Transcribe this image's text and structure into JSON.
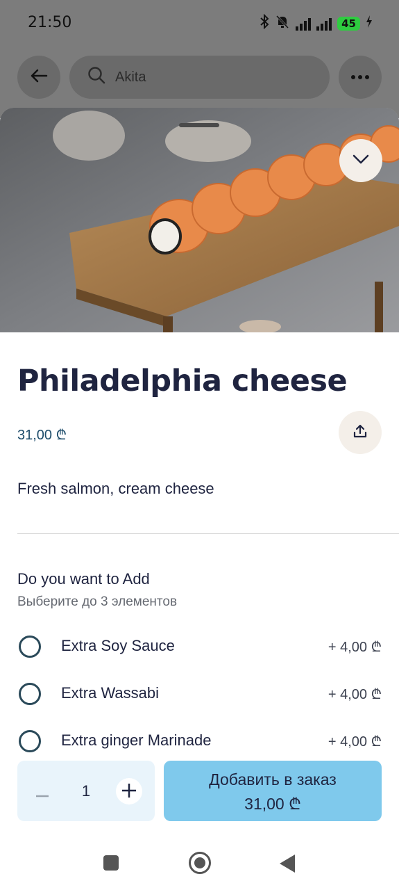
{
  "status_bar": {
    "time": "21:50",
    "icons": [
      "bluetooth-icon",
      "mute-icon",
      "signal-icon",
      "signal-icon"
    ],
    "battery": "45"
  },
  "search": {
    "value": "Akita"
  },
  "product": {
    "title": "Philadelphia cheese",
    "price": "31,00 ₾",
    "description": "Fresh salmon, cream cheese"
  },
  "addons": {
    "title": "Do you want to Add",
    "subtitle": "Выберите до 3 элементов",
    "options": [
      {
        "label": "Extra Soy Sauce",
        "price": "+ 4,00 ₾"
      },
      {
        "label": "Extra Wassabi",
        "price": "+ 4,00 ₾"
      },
      {
        "label": "Extra ginger Marinade",
        "price": "+ 4,00 ₾"
      }
    ]
  },
  "order": {
    "quantity": "1",
    "add_label": "Добавить в заказ",
    "add_total": "31,00 ₾"
  },
  "colors": {
    "accent_button": "#7fc9ec",
    "stepper_bg": "#e9f4fb",
    "title_text": "#1f2440",
    "price_text": "#1e4d6b"
  }
}
